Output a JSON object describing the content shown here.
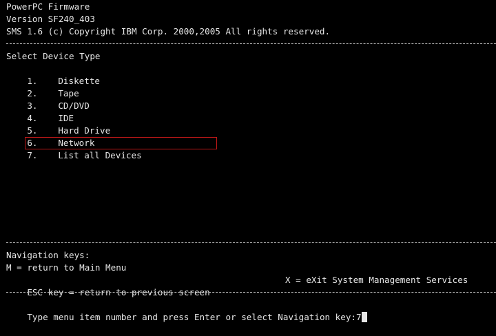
{
  "header": {
    "firmware": "PowerPC Firmware",
    "version": "Version SF240_403",
    "copyright": "SMS 1.6 (c) Copyright IBM Corp. 2000,2005 All rights reserved."
  },
  "menu": {
    "title": "Select Device Type",
    "items": [
      {
        "num": "1.",
        "label": "Diskette"
      },
      {
        "num": "2.",
        "label": "Tape"
      },
      {
        "num": "3.",
        "label": "CD/DVD"
      },
      {
        "num": "4.",
        "label": "IDE"
      },
      {
        "num": "5.",
        "label": "Hard Drive"
      },
      {
        "num": "6.",
        "label": "Network"
      },
      {
        "num": "7.",
        "label": "List all Devices"
      }
    ]
  },
  "navigation": {
    "title": "Navigation keys:",
    "main_menu": "M = return to Main Menu",
    "esc": "ESC key = return to previous screen",
    "exit": "X = eXit System Management Services"
  },
  "prompt": {
    "text": "Type menu item number and press Enter or select Navigation key:",
    "input_value": "7"
  },
  "colors": {
    "background": "#000000",
    "text": "#e6e6e6",
    "highlight_border": "#c01818"
  }
}
